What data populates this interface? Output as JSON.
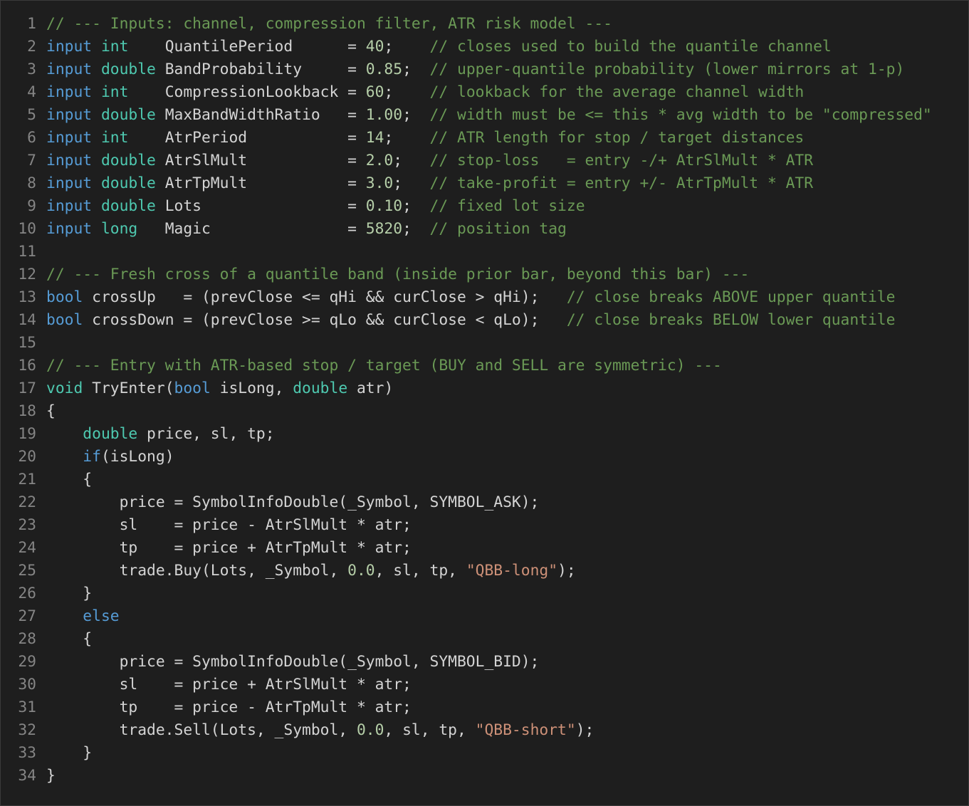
{
  "editor": {
    "language": "MQL5",
    "colors": {
      "background": "#1e1e1e",
      "keyword": "#569cd6",
      "type": "#4ec9b0",
      "comment": "#6a9955",
      "number": "#b5cea8",
      "string": "#ce9178",
      "text": "#d4d4d4",
      "line_number": "#858585"
    },
    "lines": [
      {
        "n": "1",
        "tokens": [
          [
            "c",
            "// --- Inputs: channel, compression filter, ATR risk model ---"
          ]
        ]
      },
      {
        "n": "2",
        "tokens": [
          [
            "k",
            "input"
          ],
          [
            "p",
            " "
          ],
          [
            "t",
            "int"
          ],
          [
            "p",
            "    QuantilePeriod      = "
          ],
          [
            "m",
            "40"
          ],
          [
            "p",
            ";    "
          ],
          [
            "c",
            "// closes used to build the quantile channel"
          ]
        ]
      },
      {
        "n": "3",
        "tokens": [
          [
            "k",
            "input"
          ],
          [
            "p",
            " "
          ],
          [
            "t",
            "double"
          ],
          [
            "p",
            " BandProbability     = "
          ],
          [
            "m",
            "0.85"
          ],
          [
            "p",
            ";  "
          ],
          [
            "c",
            "// upper-quantile probability (lower mirrors at 1-p)"
          ]
        ]
      },
      {
        "n": "4",
        "tokens": [
          [
            "k",
            "input"
          ],
          [
            "p",
            " "
          ],
          [
            "t",
            "int"
          ],
          [
            "p",
            "    CompressionLookback = "
          ],
          [
            "m",
            "60"
          ],
          [
            "p",
            ";    "
          ],
          [
            "c",
            "// lookback for the average channel width"
          ]
        ]
      },
      {
        "n": "5",
        "tokens": [
          [
            "k",
            "input"
          ],
          [
            "p",
            " "
          ],
          [
            "t",
            "double"
          ],
          [
            "p",
            " MaxBandWidthRatio   = "
          ],
          [
            "m",
            "1.00"
          ],
          [
            "p",
            ";  "
          ],
          [
            "c",
            "// width must be <= this * avg width to be \"compressed\""
          ]
        ]
      },
      {
        "n": "6",
        "tokens": [
          [
            "k",
            "input"
          ],
          [
            "p",
            " "
          ],
          [
            "t",
            "int"
          ],
          [
            "p",
            "    AtrPeriod           = "
          ],
          [
            "m",
            "14"
          ],
          [
            "p",
            ";    "
          ],
          [
            "c",
            "// ATR length for stop / target distances"
          ]
        ]
      },
      {
        "n": "7",
        "tokens": [
          [
            "k",
            "input"
          ],
          [
            "p",
            " "
          ],
          [
            "t",
            "double"
          ],
          [
            "p",
            " AtrSlMult           = "
          ],
          [
            "m",
            "2.0"
          ],
          [
            "p",
            ";   "
          ],
          [
            "c",
            "// stop-loss   = entry -/+ AtrSlMult * ATR"
          ]
        ]
      },
      {
        "n": "8",
        "tokens": [
          [
            "k",
            "input"
          ],
          [
            "p",
            " "
          ],
          [
            "t",
            "double"
          ],
          [
            "p",
            " AtrTpMult           = "
          ],
          [
            "m",
            "3.0"
          ],
          [
            "p",
            ";   "
          ],
          [
            "c",
            "// take-profit = entry +/- AtrTpMult * ATR"
          ]
        ]
      },
      {
        "n": "9",
        "tokens": [
          [
            "k",
            "input"
          ],
          [
            "p",
            " "
          ],
          [
            "t",
            "double"
          ],
          [
            "p",
            " Lots                = "
          ],
          [
            "m",
            "0.10"
          ],
          [
            "p",
            ";  "
          ],
          [
            "c",
            "// fixed lot size"
          ]
        ]
      },
      {
        "n": "10",
        "tokens": [
          [
            "k",
            "input"
          ],
          [
            "p",
            " "
          ],
          [
            "t",
            "long"
          ],
          [
            "p",
            "   Magic               = "
          ],
          [
            "m",
            "5820"
          ],
          [
            "p",
            ";  "
          ],
          [
            "c",
            "// position tag"
          ]
        ]
      },
      {
        "n": "11",
        "tokens": []
      },
      {
        "n": "12",
        "tokens": [
          [
            "c",
            "// --- Fresh cross of a quantile band (inside prior bar, beyond this bar) ---"
          ]
        ]
      },
      {
        "n": "13",
        "tokens": [
          [
            "k",
            "bool"
          ],
          [
            "p",
            " crossUp   = (prevClose <= qHi && curClose > qHi);   "
          ],
          [
            "c",
            "// close breaks ABOVE upper quantile"
          ]
        ]
      },
      {
        "n": "14",
        "tokens": [
          [
            "k",
            "bool"
          ],
          [
            "p",
            " crossDown = (prevClose >= qLo && curClose < qLo);   "
          ],
          [
            "c",
            "// close breaks BELOW lower quantile"
          ]
        ]
      },
      {
        "n": "15",
        "tokens": []
      },
      {
        "n": "16",
        "tokens": [
          [
            "c",
            "// --- Entry with ATR-based stop / target (BUY and SELL are symmetric) ---"
          ]
        ]
      },
      {
        "n": "17",
        "tokens": [
          [
            "t",
            "void"
          ],
          [
            "p",
            " TryEnter("
          ],
          [
            "k",
            "bool"
          ],
          [
            "p",
            " isLong, "
          ],
          [
            "t",
            "double"
          ],
          [
            "p",
            " atr)"
          ]
        ]
      },
      {
        "n": "18",
        "tokens": [
          [
            "p",
            "{"
          ]
        ]
      },
      {
        "n": "19",
        "tokens": [
          [
            "p",
            "    "
          ],
          [
            "t",
            "double"
          ],
          [
            "p",
            " price, sl, tp;"
          ]
        ]
      },
      {
        "n": "20",
        "tokens": [
          [
            "p",
            "    "
          ],
          [
            "k",
            "if"
          ],
          [
            "p",
            "(isLong)"
          ]
        ]
      },
      {
        "n": "21",
        "tokens": [
          [
            "p",
            "    {"
          ]
        ]
      },
      {
        "n": "22",
        "tokens": [
          [
            "p",
            "        price = SymbolInfoDouble(_Symbol, SYMBOL_ASK);"
          ]
        ]
      },
      {
        "n": "23",
        "tokens": [
          [
            "p",
            "        sl    = price - AtrSlMult * atr;"
          ]
        ]
      },
      {
        "n": "24",
        "tokens": [
          [
            "p",
            "        tp    = price + AtrTpMult * atr;"
          ]
        ]
      },
      {
        "n": "25",
        "tokens": [
          [
            "p",
            "        trade.Buy(Lots, _Symbol, "
          ],
          [
            "m",
            "0.0"
          ],
          [
            "p",
            ", sl, tp, "
          ],
          [
            "s",
            "\"QBB-long\""
          ],
          [
            "p",
            ");"
          ]
        ]
      },
      {
        "n": "26",
        "tokens": [
          [
            "p",
            "    }"
          ]
        ]
      },
      {
        "n": "27",
        "tokens": [
          [
            "p",
            "    "
          ],
          [
            "k",
            "else"
          ]
        ]
      },
      {
        "n": "28",
        "tokens": [
          [
            "p",
            "    {"
          ]
        ]
      },
      {
        "n": "29",
        "tokens": [
          [
            "p",
            "        price = SymbolInfoDouble(_Symbol, SYMBOL_BID);"
          ]
        ]
      },
      {
        "n": "30",
        "tokens": [
          [
            "p",
            "        sl    = price + AtrSlMult * atr;"
          ]
        ]
      },
      {
        "n": "31",
        "tokens": [
          [
            "p",
            "        tp    = price - AtrTpMult * atr;"
          ]
        ]
      },
      {
        "n": "32",
        "tokens": [
          [
            "p",
            "        trade.Sell(Lots, _Symbol, "
          ],
          [
            "m",
            "0.0"
          ],
          [
            "p",
            ", sl, tp, "
          ],
          [
            "s",
            "\"QBB-short\""
          ],
          [
            "p",
            ");"
          ]
        ]
      },
      {
        "n": "33",
        "tokens": [
          [
            "p",
            "    }"
          ]
        ]
      },
      {
        "n": "34",
        "tokens": [
          [
            "p",
            "}"
          ]
        ]
      }
    ]
  }
}
